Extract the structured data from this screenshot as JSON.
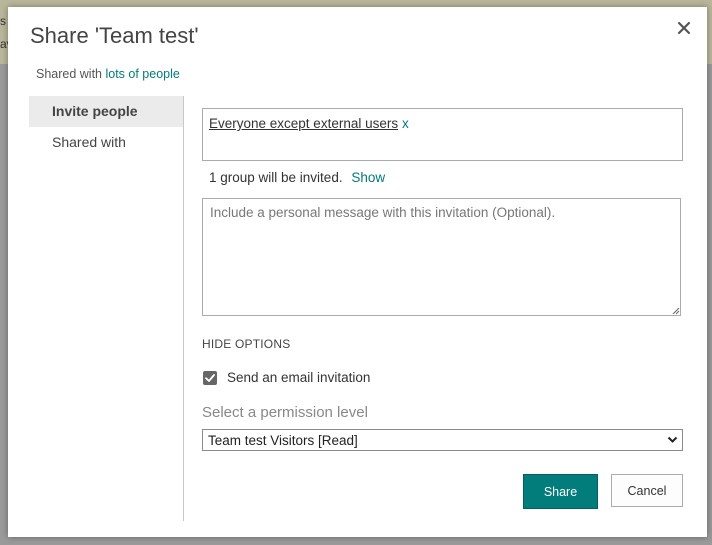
{
  "background": {
    "fragments": [
      "s",
      "av"
    ]
  },
  "dialog": {
    "title": "Share 'Team test'",
    "shared_with_prefix": "Shared with ",
    "shared_with_link": "lots of people"
  },
  "sidebar": {
    "items": [
      {
        "label": "Invite people",
        "active": true
      },
      {
        "label": "Shared with",
        "active": false
      }
    ]
  },
  "invite": {
    "people": [
      {
        "name": "Everyone except external users",
        "remove": "x"
      }
    ],
    "group_text": "1 group will be invited.",
    "group_link": "Show",
    "message_placeholder": "Include a personal message with this invitation (Optional).",
    "message_value": ""
  },
  "options": {
    "toggle_label": "HIDE OPTIONS",
    "email_checkbox_label": "Send an email invitation",
    "email_checked": true,
    "permission_label": "Select a permission level",
    "permission_value": "Team test Visitors [Read]"
  },
  "buttons": {
    "share": "Share",
    "cancel": "Cancel"
  },
  "colors": {
    "accent": "#037c7c",
    "link": "#047a7a",
    "sidebar_active_bg": "#ebebeb"
  },
  "icons": {
    "close": "close-icon",
    "checkbox": "checkmark-icon",
    "dropdown": "chevron-down-icon",
    "resize": "resize-grip-icon"
  }
}
